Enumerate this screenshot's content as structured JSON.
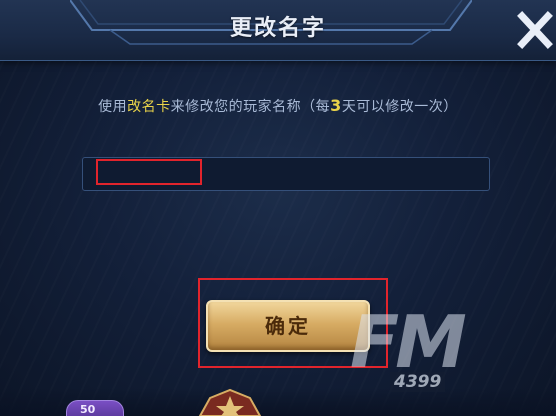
{
  "dialog": {
    "title": "更改名字",
    "close_icon": "close-x-icon"
  },
  "instruction": {
    "part1": "使用",
    "highlight1": "改名卡",
    "part2": "来修改您的玩家名称（每",
    "highlight_num": "3",
    "part3": "天可以修改一次）"
  },
  "name_input": {
    "value": "",
    "placeholder": ""
  },
  "confirm": {
    "label": "确定"
  },
  "watermark": {
    "text": "FM",
    "sub": "4399"
  },
  "bottom": {
    "badge_text": "50"
  },
  "colors": {
    "highlight": "#e9d34a",
    "annotation_red": "#e1242c",
    "button_gold": "#d7ac64",
    "panel_bg": "#13203a"
  }
}
